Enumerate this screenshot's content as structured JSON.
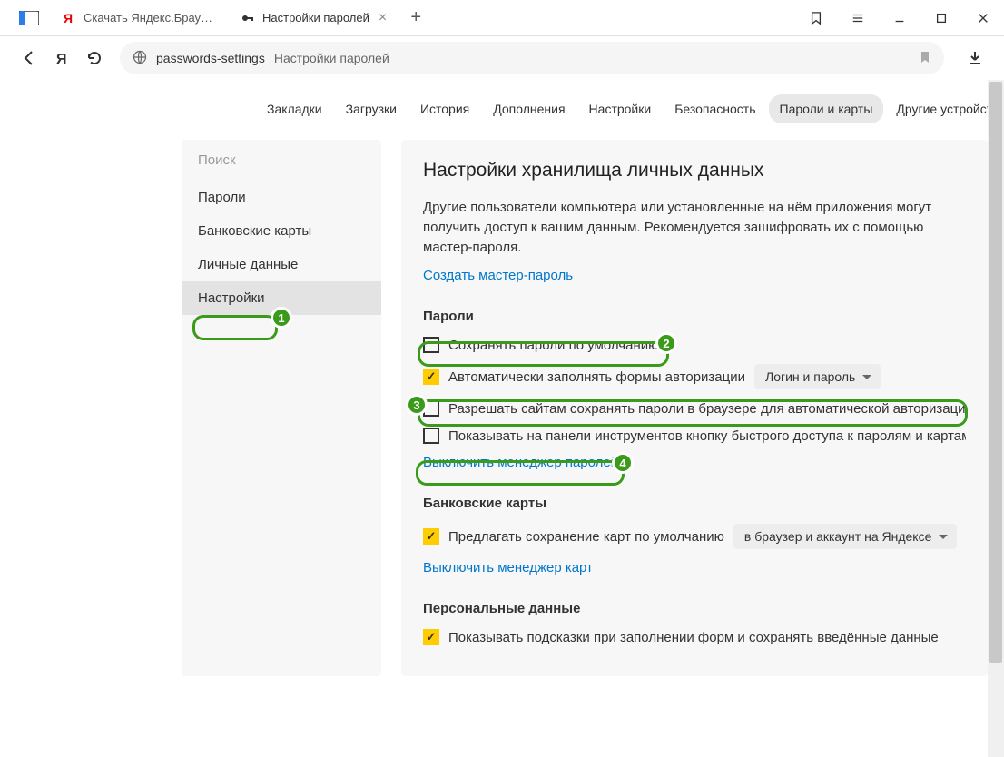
{
  "tabs": {
    "inactive_title": "Скачать Яндекс.Браузер д",
    "active_title": "Настройки паролей"
  },
  "omnibox": {
    "path": "passwords-settings",
    "title": "Настройки паролей"
  },
  "topnav": {
    "items": [
      "Закладки",
      "Загрузки",
      "История",
      "Дополнения",
      "Настройки",
      "Безопасность",
      "Пароли и карты",
      "Другие устройства"
    ]
  },
  "sidebar": {
    "search_placeholder": "Поиск",
    "items": [
      "Пароли",
      "Банковские карты",
      "Личные данные",
      "Настройки"
    ]
  },
  "main": {
    "heading": "Настройки хранилища личных данных",
    "description": "Другие пользователи компьютера или установленные на нём приложения могут получить доступ к вашим данным. Рекомендуется зашифровать их с помощью мастер-пароля.",
    "create_master_link": "Создать мастер-пароль",
    "passwords": {
      "title": "Пароли",
      "save_default": "Сохранять пароли по умолчанию",
      "autofill": "Автоматически заполнять формы авторизации",
      "autofill_select": "Логин и пароль",
      "allow_sites": "Разрешать сайтам сохранять пароли в браузере для автоматической авторизации",
      "toolbar_btn": "Показывать на панели инструментов кнопку быстрого доступа к паролям и картам",
      "disable_link": "Выключить менеджер паролей"
    },
    "cards": {
      "title": "Банковские карты",
      "save_default": "Предлагать сохранение карт по умолчанию",
      "save_select": "в браузер и аккаунт на Яндексе",
      "disable_link": "Выключить менеджер карт"
    },
    "personal": {
      "title": "Персональные данные",
      "show_hints": "Показывать подсказки при заполнении форм и сохранять введённые данные"
    }
  },
  "badges": {
    "b1": "1",
    "b2": "2",
    "b3": "3",
    "b4": "4"
  }
}
